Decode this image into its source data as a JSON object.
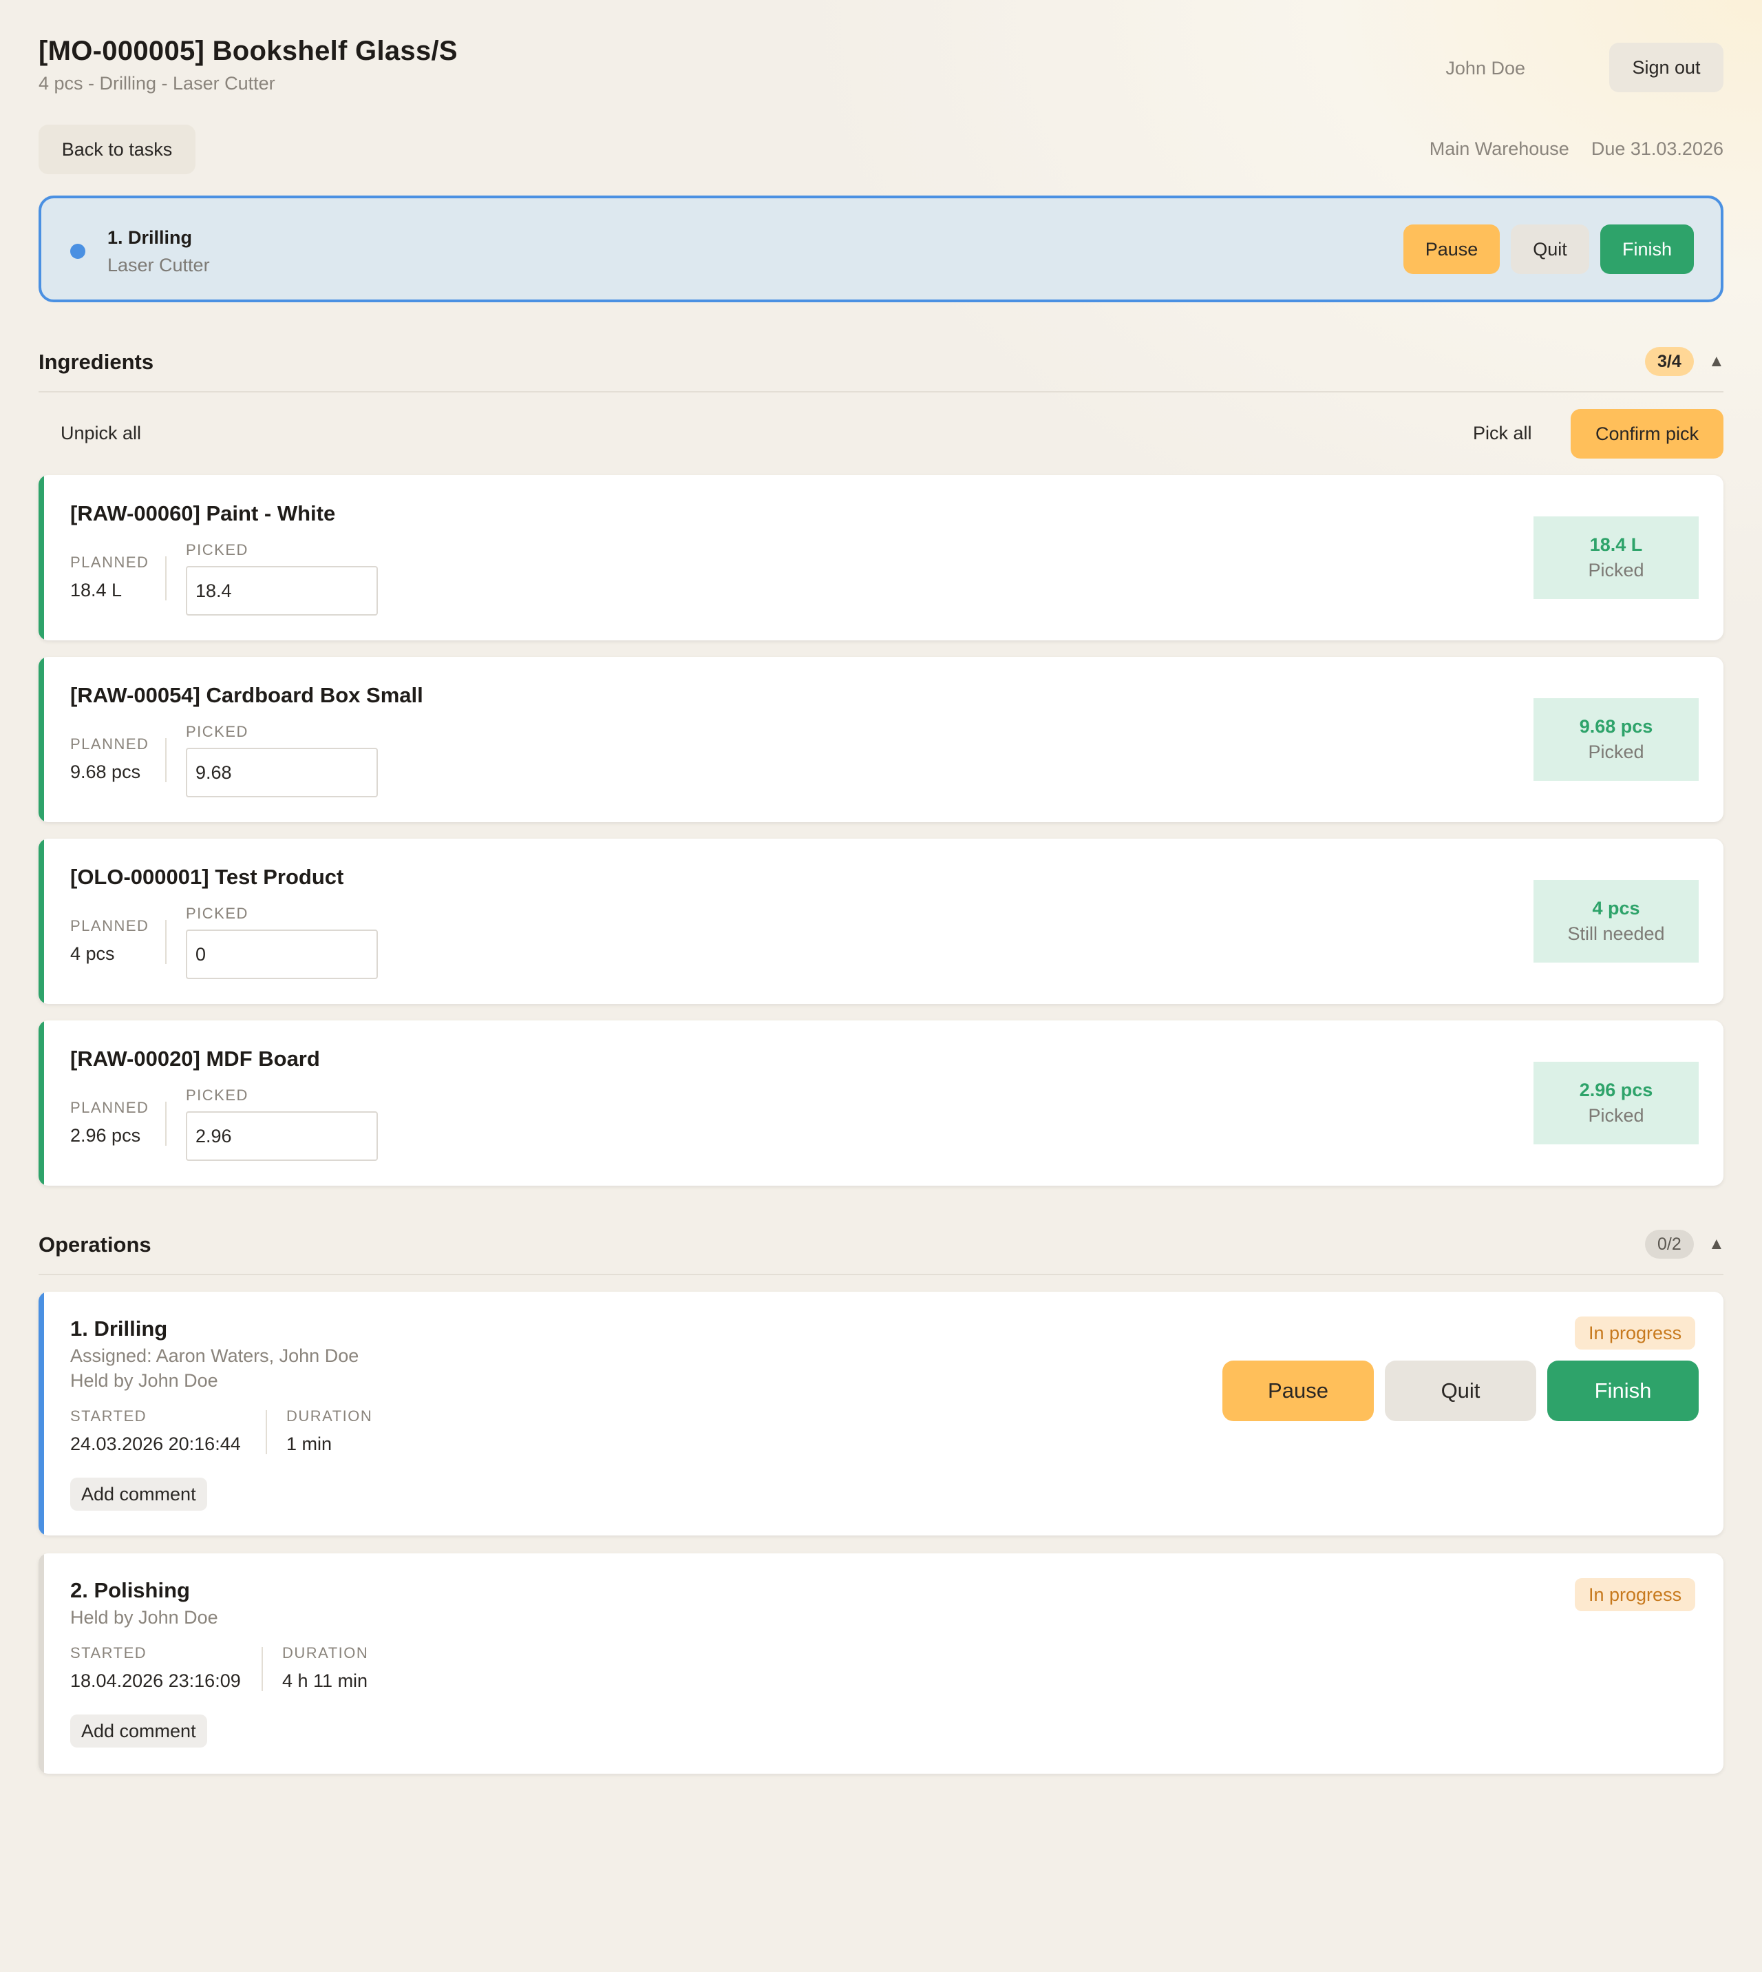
{
  "header": {
    "title": "[MO-000005] Bookshelf Glass/S",
    "subtitle": "4 pcs - Drilling - Laser Cutter",
    "user": "John Doe",
    "sign_out": "Sign out",
    "back": "Back to tasks",
    "warehouse": "Main Warehouse",
    "due": "Due 31.03.2026"
  },
  "active_operation": {
    "name": "1. Drilling",
    "resource": "Laser Cutter",
    "pause": "Pause",
    "quit": "Quit",
    "finish": "Finish"
  },
  "ingredients": {
    "title": "Ingredients",
    "count": "3/4",
    "toggle_icon": "▲",
    "unpick_all": "Unpick all",
    "pick_all": "Pick all",
    "confirm_pick": "Confirm pick",
    "planned_label": "PLANNED",
    "picked_label": "PICKED",
    "items": [
      {
        "name": "[RAW-00060] Paint - White",
        "planned": "18.4 L",
        "picked": "18.4",
        "status_qty": "18.4 L",
        "status": "Picked"
      },
      {
        "name": "[RAW-00054] Cardboard Box Small",
        "planned": "9.68 pcs",
        "picked": "9.68",
        "status_qty": "9.68 pcs",
        "status": "Picked"
      },
      {
        "name": "[OLO-000001] Test Product",
        "planned": "4 pcs",
        "picked": "0",
        "status_qty": "4 pcs",
        "status": "Still needed"
      },
      {
        "name": "[RAW-00020] MDF Board",
        "planned": "2.96 pcs",
        "picked": "2.96",
        "status_qty": "2.96 pcs",
        "status": "Picked"
      }
    ]
  },
  "operations": {
    "title": "Operations",
    "count": "0/2",
    "toggle_icon": "▲",
    "started_label": "STARTED",
    "duration_label": "DURATION",
    "add_comment": "Add comment",
    "items": [
      {
        "name": "1. Drilling",
        "assigned": "Assigned: Aaron Waters, John Doe",
        "held_by": "Held by John Doe",
        "started": "24.03.2026 20:16:44",
        "duration": "1 min",
        "state": "In progress",
        "pause": "Pause",
        "quit": "Quit",
        "finish": "Finish"
      },
      {
        "name": "2. Polishing",
        "held_by": "Held by John Doe",
        "started": "18.04.2026 23:16:09",
        "duration": "4 h 11 min",
        "state": "In progress"
      }
    ]
  },
  "colors": {
    "accent_orange": "#ffbf5a",
    "accent_green": "#2ea36a",
    "accent_blue": "#4a90e2",
    "status_orange": "#c7791d"
  }
}
